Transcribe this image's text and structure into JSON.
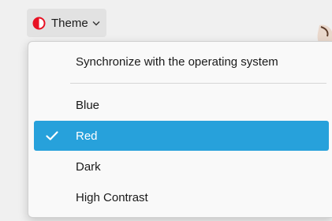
{
  "theme_button": {
    "label": "Theme",
    "icon": "contrast-icon",
    "icon_color": "#e81123",
    "chevron": "chevron-down-icon"
  },
  "menu": {
    "sync_option": "Synchronize with the operating system",
    "items": [
      {
        "label": "Blue",
        "selected": false
      },
      {
        "label": "Red",
        "selected": true
      },
      {
        "label": "Dark",
        "selected": false
      },
      {
        "label": "High Contrast",
        "selected": false
      }
    ],
    "selected_color": "#27a1db",
    "check_icon": "checkmark-icon"
  }
}
